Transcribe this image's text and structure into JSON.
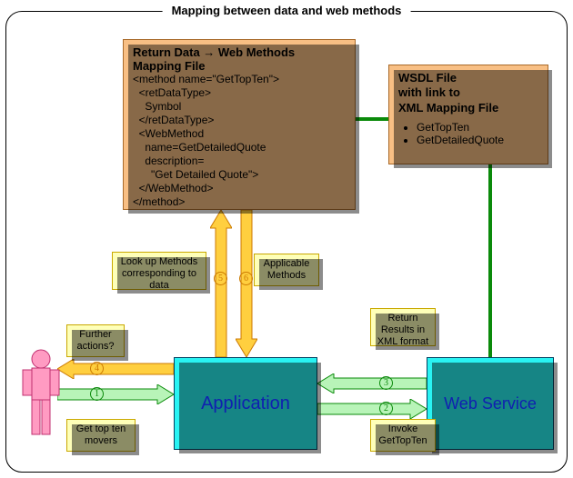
{
  "title": "Mapping between data and web methods",
  "mapping": {
    "heading": "Return Data → Web Methods Mapping File",
    "code": "<method name=\"GetTopTen\">\n  <retDataType>\n    Symbol\n  </retDataType>\n  <WebMethod\n    name=GetDetailedQuote\n    description=\n      \"Get Detailed Quote\">\n  </WebMethod>\n</method>"
  },
  "wsdl": {
    "heading": "WSDL File\nwith link to\nXML Mapping File",
    "items": [
      "GetTopTen",
      "GetDetailedQuote"
    ]
  },
  "app_label": "Application",
  "ws_label": "Web Service",
  "notes": {
    "lookup": "Look up Methods corresponding to data",
    "applicable": "Applicable Methods",
    "further": "Further actions?",
    "getten": "Get top ten movers",
    "ret": "Return Results in XML format",
    "invoke": "Invoke GetTopTen"
  },
  "steps": {
    "s1": "1",
    "s2": "2",
    "s3": "3",
    "s4": "4",
    "s5": "5",
    "s6": "6"
  }
}
